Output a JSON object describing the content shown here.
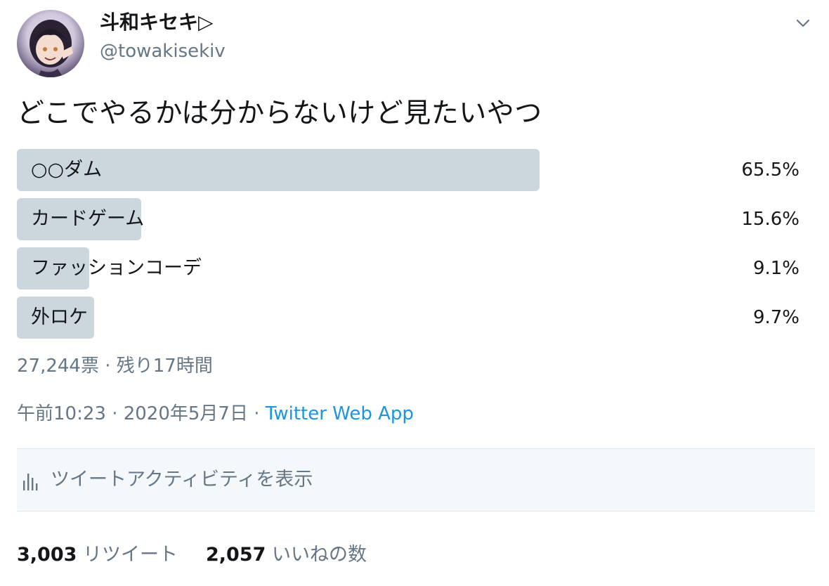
{
  "user": {
    "display_name": "斗和キセキ▷",
    "handle": "@towakisekiv",
    "avatar_icon": "avatar-image"
  },
  "tweet": {
    "text": "どこでやるかは分からないけど見たいやつ"
  },
  "poll": {
    "options": [
      {
        "label": "○○ダム",
        "percent": "65.5%",
        "fraction": 0.655,
        "winner": true
      },
      {
        "label": "カードゲーム",
        "percent": "15.6%",
        "fraction": 0.156
      },
      {
        "label": "ファッションコーデ",
        "percent": "9.1%",
        "fraction": 0.091
      },
      {
        "label": "外ロケ",
        "percent": "9.7%",
        "fraction": 0.097
      }
    ],
    "summary": "27,244票 · 残り17時間"
  },
  "meta": {
    "time": "午前10:23 · 2020年5月7日 · ",
    "source": "Twitter Web App"
  },
  "activity": {
    "label": "ツイートアクティビティを表示",
    "icon": "bar-chart-icon"
  },
  "stats": {
    "retweets_count": "3,003",
    "retweets_label": "リツイート",
    "likes_count": "2,057",
    "likes_label": "いいねの数"
  },
  "colors": {
    "bar": "#ccd6dd",
    "secondary_text": "#657786",
    "link": "#1b95e0",
    "activity_bg": "#f5f8fa"
  }
}
